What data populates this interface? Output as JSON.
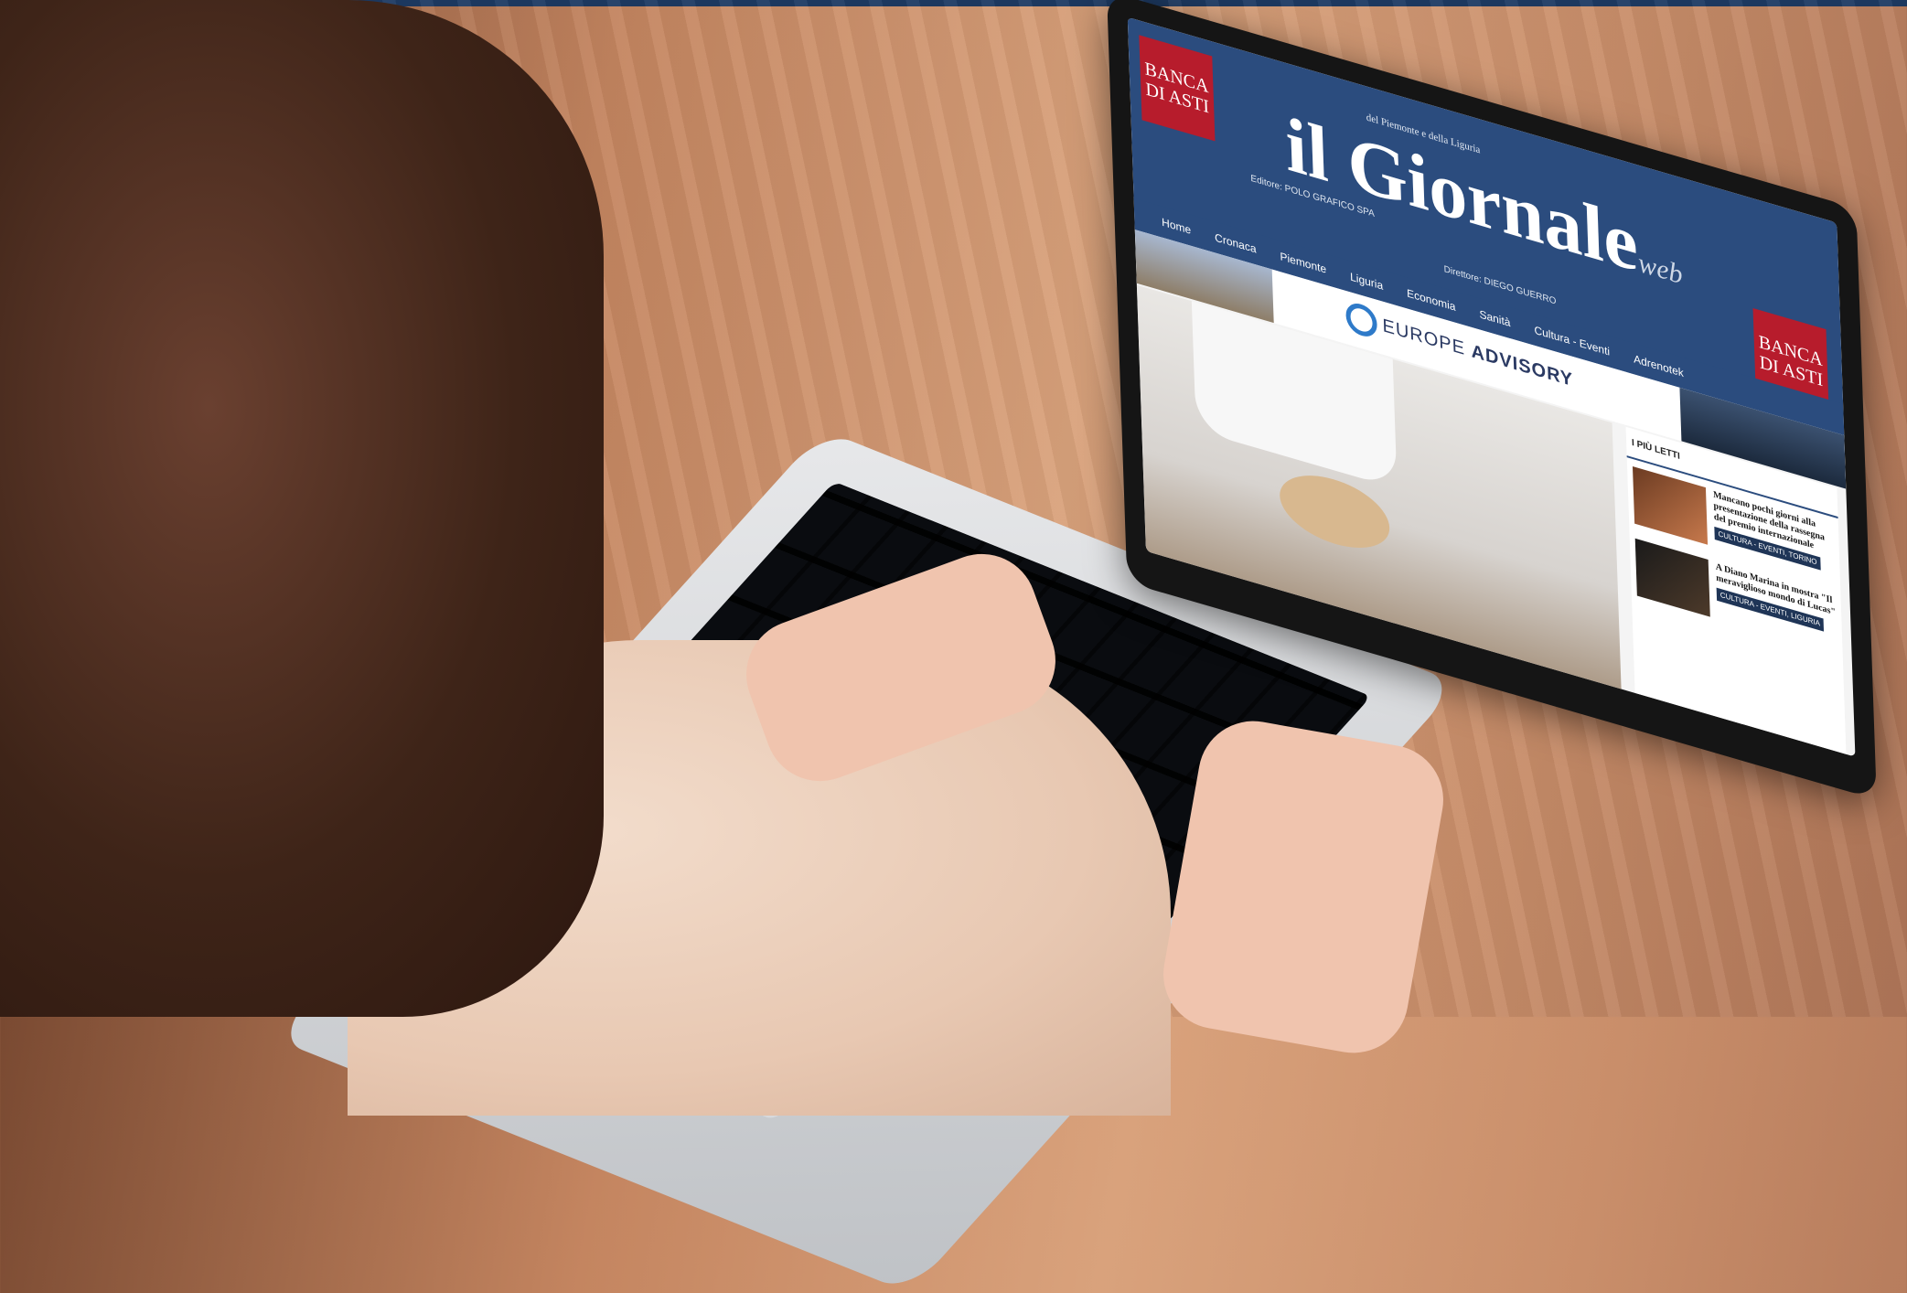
{
  "site": {
    "bank_logo": "BANCA DI ASTI",
    "masthead": "il Giornale",
    "masthead_suffix": "web",
    "tagline": "del Piemonte e della Liguria",
    "editor": "Editore: POLO GRAFICO SPA",
    "director": "Direttore: DIEGO GUERRO",
    "nav": [
      "Home",
      "Cronaca",
      "Piemonte",
      "Liguria",
      "Economia",
      "Sanità",
      "Cultura - Eventi",
      "Adrenotek"
    ],
    "breadcrumb": "Cultura - Eventi",
    "ad_text_light": "EUROPE",
    "ad_text_bold": "ADVISORY",
    "sidebar_title": "I PIÙ LETTI",
    "posts": [
      {
        "title": "Mancano pochi giorni alla presentazione della rassegna del premio internazionale",
        "tags": "CULTURA - EVENTI, TORINO"
      },
      {
        "title": "A Diano Marina in mostra \"Il meraviglioso mondo di Lucas\"",
        "tags": "CULTURA - EVENTI, LIGURIA"
      }
    ]
  },
  "colors": {
    "brand_blue": "#2b4c7e",
    "bank_red": "#b71c2c",
    "top_strip": "#1d3a63"
  }
}
